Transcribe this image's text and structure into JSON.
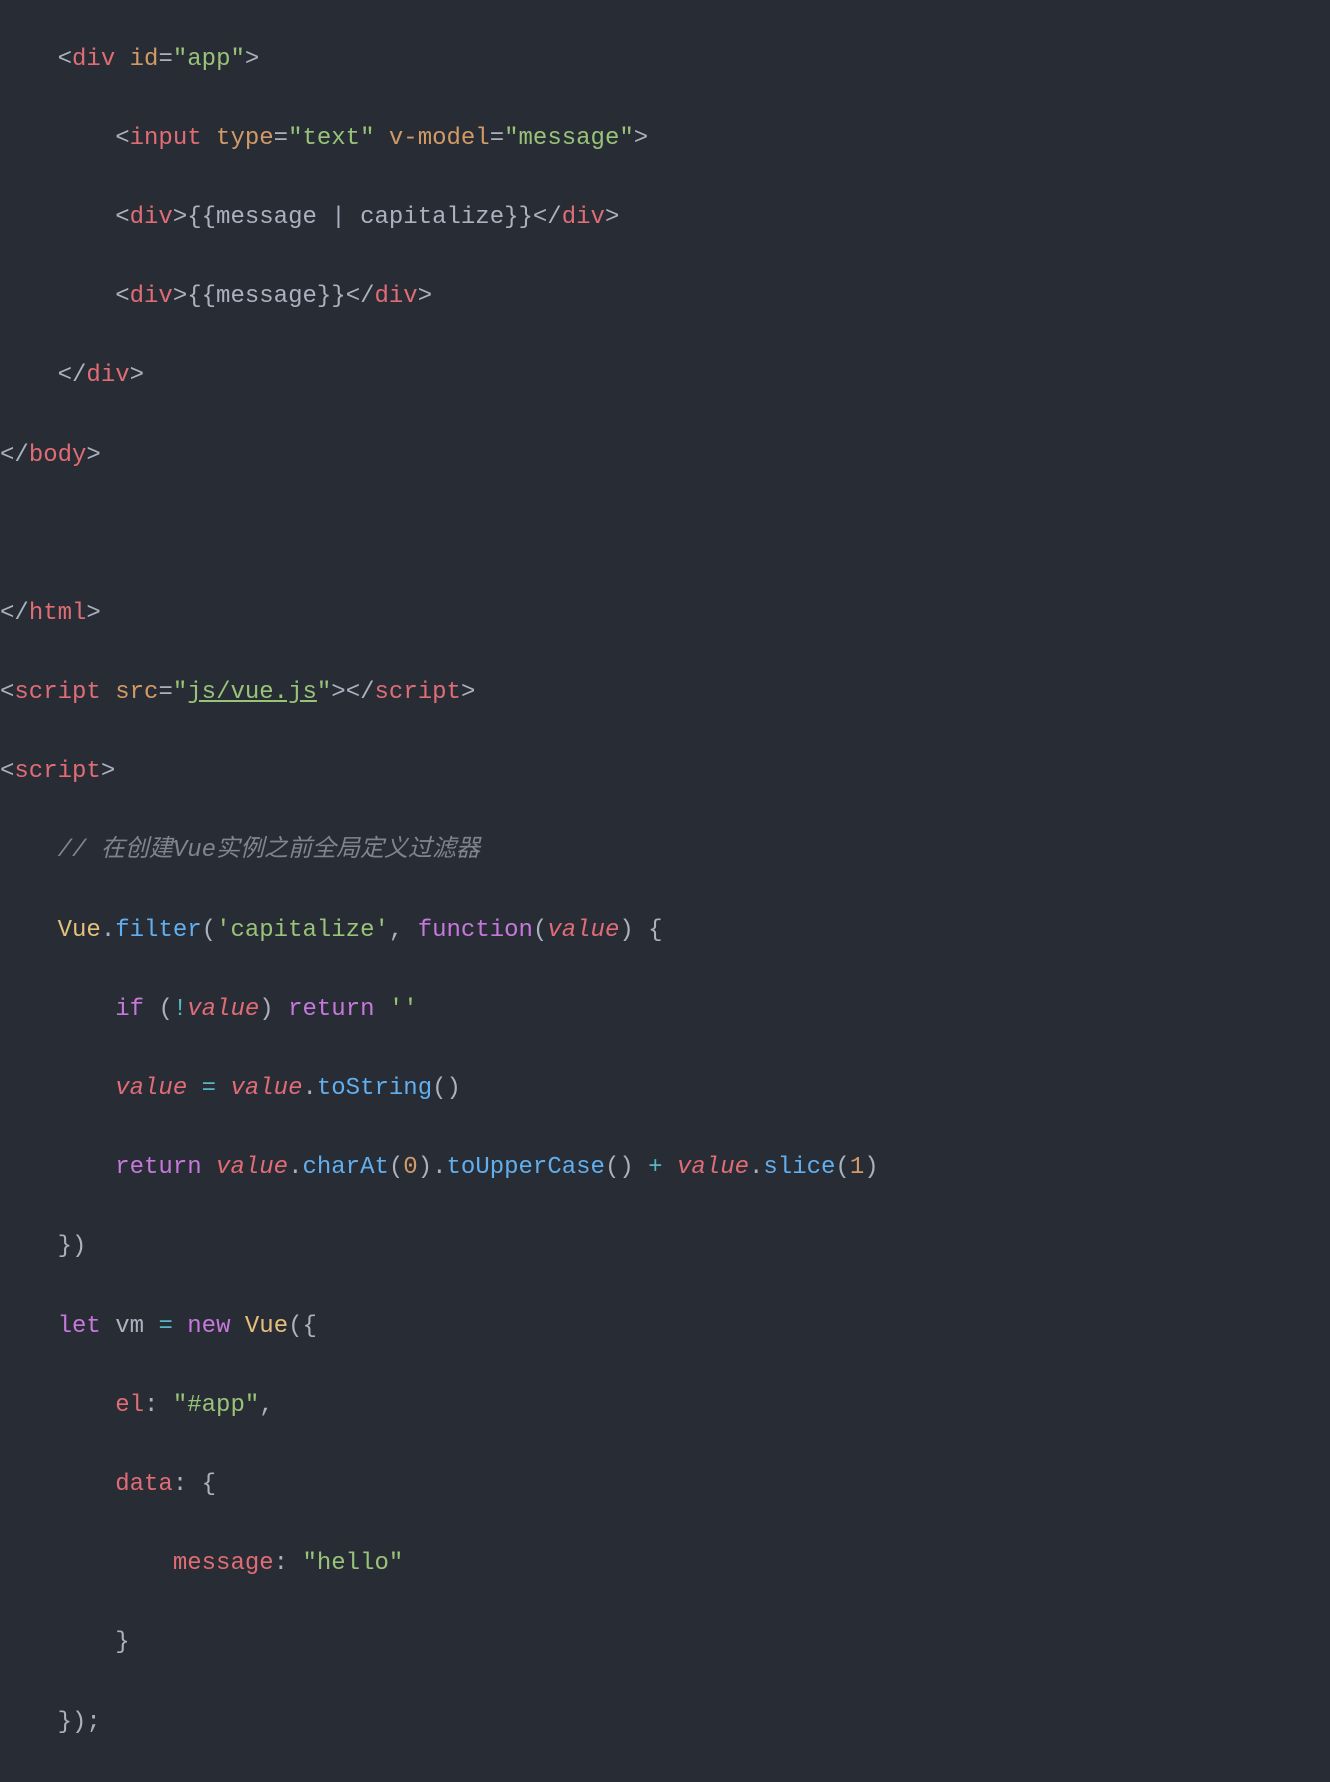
{
  "lines": {
    "l1": {
      "indent": "    ",
      "p1": "<",
      "tag1": "div",
      "sp1": " ",
      "attr1": "id",
      "eq1": "=",
      "str1": "\"app\"",
      "p2": ">"
    },
    "l2": {
      "indent": "        ",
      "p1": "<",
      "tag1": "input",
      "sp1": " ",
      "attr1": "type",
      "eq1": "=",
      "str1": "\"text\"",
      "sp2": " ",
      "attr2": "v-model",
      "eq2": "=",
      "str2": "\"message\"",
      "p2": ">"
    },
    "l3": {
      "indent": "        ",
      "p1": "<",
      "tag1": "div",
      "p2": ">",
      "text1": "{{message | capitalize}}",
      "p3": "</",
      "tag2": "div",
      "p4": ">"
    },
    "l4": {
      "indent": "        ",
      "p1": "<",
      "tag1": "div",
      "p2": ">",
      "text1": "{{message}}",
      "p3": "</",
      "tag2": "div",
      "p4": ">"
    },
    "l5": {
      "indent": "    ",
      "p1": "</",
      "tag1": "div",
      "p2": ">"
    },
    "l6": {
      "p1": "</",
      "tag1": "body",
      "p2": ">"
    },
    "l7": {
      "text": ""
    },
    "l8": {
      "p1": "</",
      "tag1": "html",
      "p2": ">"
    },
    "l9": {
      "p1": "<",
      "tag1": "script",
      "sp1": " ",
      "attr1": "src",
      "eq1": "=",
      "str1": "\"",
      "str2": "js/vue.js",
      "str3": "\"",
      "p2": ">",
      "p3": "</",
      "tag2": "script",
      "p4": ">"
    },
    "l10": {
      "p1": "<",
      "tag1": "script",
      "p2": ">"
    },
    "l11": {
      "indent": "    ",
      "comment": "// 在创建Vue实例之前全局定义过滤器"
    },
    "l12": {
      "indent": "    ",
      "const1": "Vue",
      "p1": ".",
      "func1": "filter",
      "p2": "(",
      "str1": "'capitalize'",
      "p3": ", ",
      "kw1": "function",
      "p4": "(",
      "param1": "value",
      "p5": ") {"
    },
    "l13": {
      "indent": "        ",
      "kw1": "if",
      "sp1": " ",
      "p1": "(",
      "op1": "!",
      "var1": "value",
      "p2": ") ",
      "kw2": "return",
      "sp2": " ",
      "str1": "''"
    },
    "l14": {
      "indent": "        ",
      "var1": "value",
      "sp1": " ",
      "op1": "=",
      "sp2": " ",
      "var2": "value",
      "p1": ".",
      "func1": "toString",
      "p2": "()"
    },
    "l15": {
      "indent": "        ",
      "kw1": "return",
      "sp1": " ",
      "var1": "value",
      "p1": ".",
      "func1": "charAt",
      "p2": "(",
      "num1": "0",
      "p3": ").",
      "func2": "toUpperCase",
      "p4": "() ",
      "op1": "+",
      "sp2": " ",
      "var2": "value",
      "p5": ".",
      "func3": "slice",
      "p6": "(",
      "num2": "1",
      "p7": ")"
    },
    "l16": {
      "indent": "    ",
      "p1": "})"
    },
    "l17": {
      "indent": "    ",
      "kw1": "let",
      "sp1": " ",
      "def1": "vm ",
      "op1": "=",
      "sp2": " ",
      "kw2": "new",
      "sp3": " ",
      "const1": "Vue",
      "p1": "({"
    },
    "l18": {
      "indent": "        ",
      "key1": "el",
      "p1": ": ",
      "str1": "\"#app\"",
      "p2": ","
    },
    "l19": {
      "indent": "        ",
      "key1": "data",
      "p1": ": {"
    },
    "l20": {
      "indent": "            ",
      "key1": "message",
      "p1": ": ",
      "str1": "\"hello\""
    },
    "l21": {
      "indent": "        ",
      "p1": "}"
    },
    "l22": {
      "indent": "    ",
      "p1": "});"
    }
  }
}
